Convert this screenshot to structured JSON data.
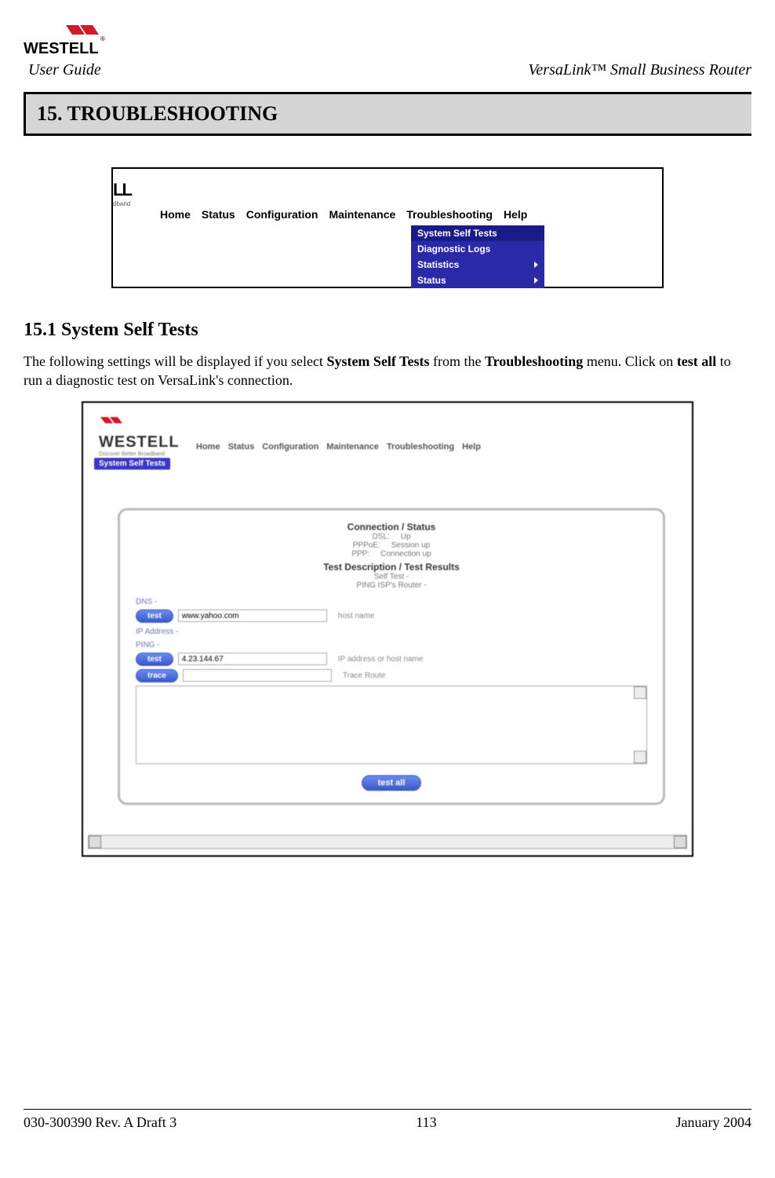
{
  "header": {
    "brand_top": "WESTELL",
    "user_guide": "User Guide",
    "product": "VersaLink™  Small Business Router"
  },
  "section": {
    "banner": "15.  TROUBLESHOOTING",
    "sub": "15.1 System Self Tests",
    "para_a": "The following settings will be displayed if you select ",
    "para_b": "System Self Tests",
    "para_c": " from the ",
    "para_d": "Troubleshooting",
    "para_e": " menu. Click on ",
    "para_f": "test all",
    "para_g": " to run a diagnostic test on VersaLink's connection."
  },
  "ss1": {
    "logo_frag": "LL",
    "logo_tag": "dband",
    "nav": [
      "Home",
      "Status",
      "Configuration",
      "Maintenance",
      "Troubleshooting",
      "Help"
    ],
    "dropdown": [
      "System Self Tests",
      "Diagnostic Logs",
      "Statistics",
      "Status"
    ]
  },
  "ss2": {
    "brand": "WESTELL",
    "brand_tag": "Discover Better Broadband",
    "nav": [
      "Home",
      "Status",
      "Configuration",
      "Maintenance",
      "Troubleshooting",
      "Help"
    ],
    "breadcrumb": "System Self Tests",
    "conn_title": "Connection / Status",
    "conn_rows": [
      {
        "k": "DSL:",
        "v": "Up"
      },
      {
        "k": "PPPoE:",
        "v": "Session up"
      },
      {
        "k": "PPP:",
        "v": "Connection up"
      }
    ],
    "test_title": "Test Description / Test Results",
    "test_rows": [
      "Self Test            -",
      "PING ISP's Router -"
    ],
    "dns_label": "DNS       -",
    "ip_label_1": "IP Address -",
    "ip_label_2": "PING       -",
    "btn_test": "test",
    "btn_trace": "trace",
    "host_input": "www.yahoo.com",
    "ip_input": "4.23.144.67",
    "host_hint": "host name",
    "ip_hint": "IP address or host name",
    "trace_hint": "Trace Route",
    "btn_testall": "test all"
  },
  "footer": {
    "left": "030-300390 Rev. A Draft 3",
    "center": "113",
    "right": "January 2004"
  }
}
